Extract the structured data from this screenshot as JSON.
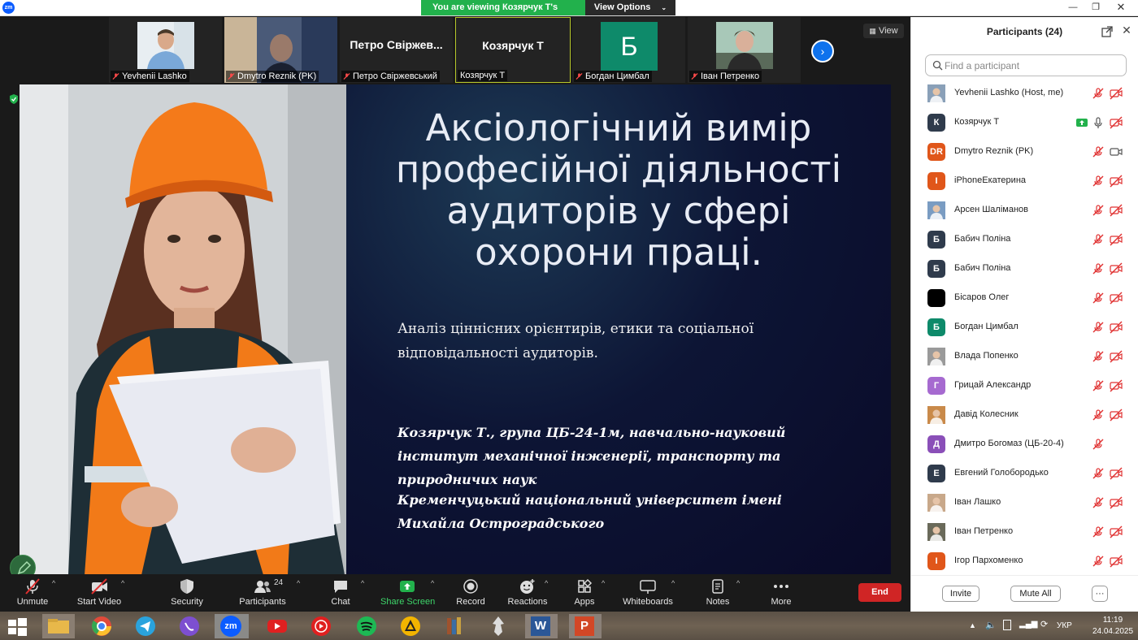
{
  "titlebar": {
    "app_logo": "zm",
    "viewing_text": "You are viewing Козярчук Т's screen",
    "view_options": "View Options"
  },
  "strip": {
    "tiles": [
      {
        "name": "Yevhenii Lashko",
        "kind": "photo",
        "muted": true
      },
      {
        "name": "Dmytro Reznik (PK)",
        "kind": "photo",
        "muted": true
      },
      {
        "name": "Петро Свіржевський",
        "big": "Петро  Свіржев...",
        "kind": "text",
        "muted": true
      },
      {
        "name": "Козярчук Т",
        "big": "Козярчук Т",
        "kind": "text",
        "muted": false,
        "active": true
      },
      {
        "name": "Богдан Цимбал",
        "letter": "Б",
        "kind": "letter",
        "muted": true
      },
      {
        "name": "Іван Петренко",
        "kind": "photo",
        "muted": true
      }
    ],
    "view_label": "View"
  },
  "slide": {
    "title": "Аксіологічний вимір професійної діяльності аудиторів у сфері охорони праці.",
    "subtitle": "Аналіз ціннісних орієнтирів, етики та соціальної відповідальності аудиторів.",
    "author": "Козярчук Т., група ЦБ-24-1м, навчально-науковий інститут механічної інженерії, транспорту та природничих наук",
    "university": "Кременчуцький національний університет імені Михайла Остроградського"
  },
  "toolbar": {
    "unmute": "Unmute",
    "start_video": "Start Video",
    "security": "Security",
    "participants": "Participants",
    "participants_count": "24",
    "chat": "Chat",
    "share_screen": "Share Screen",
    "record": "Record",
    "reactions": "Reactions",
    "apps": "Apps",
    "whiteboards": "Whiteboards",
    "notes": "Notes",
    "more": "More",
    "end": "End"
  },
  "panel": {
    "title": "Participants (24)",
    "search_placeholder": "Find a participant",
    "participants": [
      {
        "name": "Yevhenii Lashko (Host, me)",
        "avatar": "photo",
        "color": "#8aa0b8",
        "mic": "muted",
        "video": "off"
      },
      {
        "name": "Козярчук Т",
        "avatar": "К",
        "color": "#2f3b4c",
        "mic": "on",
        "video": "off",
        "sharing": true
      },
      {
        "name": "Dmytro Reznik (PK)",
        "avatar": "DR",
        "color": "#e0561a",
        "mic": "muted",
        "video": "on"
      },
      {
        "name": "iPhoneЕкатерина",
        "avatar": "I",
        "color": "#e0561a",
        "mic": "muted",
        "video": "off"
      },
      {
        "name": "Арсен Шаліманов",
        "avatar": "photo",
        "color": "#7a9cc2",
        "mic": "muted",
        "video": "off"
      },
      {
        "name": "Бабич Поліна",
        "avatar": "Б",
        "color": "#2f3b4c",
        "mic": "muted",
        "video": "off"
      },
      {
        "name": "Бабич Поліна",
        "avatar": "Б",
        "color": "#2f3b4c",
        "mic": "muted",
        "video": "off"
      },
      {
        "name": "Бісаров Олег",
        "avatar": "",
        "color": "#000000",
        "mic": "muted",
        "video": "off"
      },
      {
        "name": "Богдан Цимбал",
        "avatar": "Б",
        "color": "#0e8a6a",
        "mic": "muted",
        "video": "off"
      },
      {
        "name": "Влада Попенко",
        "avatar": "photo",
        "color": "#9a9a9a",
        "mic": "muted",
        "video": "off"
      },
      {
        "name": "Грицай Александр",
        "avatar": "Г",
        "color": "#a66ad0",
        "mic": "muted",
        "video": "off"
      },
      {
        "name": "Давід Колесник",
        "avatar": "photo",
        "color": "#c98a4a",
        "mic": "muted",
        "video": "off"
      },
      {
        "name": "Дмитро Богомаз (ЦБ-20-4)",
        "avatar": "Д",
        "color": "#8a4fb8",
        "mic": "muted",
        "video": "none"
      },
      {
        "name": "Евгений Голобородько",
        "avatar": "Е",
        "color": "#2f3b4c",
        "mic": "muted",
        "video": "off"
      },
      {
        "name": "Іван Лашко",
        "avatar": "photo",
        "color": "#c8a88a",
        "mic": "muted",
        "video": "off"
      },
      {
        "name": "Іван Петренко",
        "avatar": "photo",
        "color": "#6a6a5a",
        "mic": "muted",
        "video": "off"
      },
      {
        "name": "Ігор Пархоменко",
        "avatar": "І",
        "color": "#e0561a",
        "mic": "muted",
        "video": "off"
      }
    ],
    "invite": "Invite",
    "mute_all": "Mute All",
    "more": "···"
  },
  "taskbar": {
    "apps": [
      "windows-icon",
      "file-explorer-icon",
      "chrome-icon",
      "telegram-icon",
      "viber-icon",
      "zoom-icon",
      "youtube-icon",
      "youtube-music-icon",
      "spotify-icon",
      "aimp-icon",
      "books-icon",
      "skyrim-icon",
      "word-icon",
      "powerpoint-icon"
    ],
    "zoom_label": "zm",
    "word_label": "W",
    "ppt_label": "P",
    "lang": "УКР",
    "time": "11:19",
    "date": "24.04.2025"
  }
}
